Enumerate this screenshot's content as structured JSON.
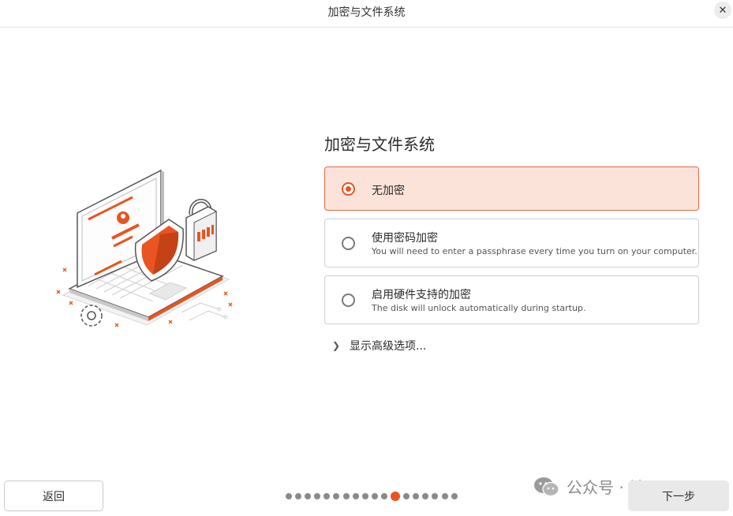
{
  "window": {
    "title": "加密与文件系统"
  },
  "main": {
    "heading": "加密与文件系统",
    "options": [
      {
        "label": "无加密",
        "description": "",
        "selected": true
      },
      {
        "label": "使用密码加密",
        "description": "You will need to enter a passphrase every time you turn on your computer.",
        "selected": false
      },
      {
        "label": "启用硬件支持的加密",
        "description": "The disk will unlock automatically during startup.",
        "selected": false
      }
    ],
    "advanced_label": "显示高级选项..."
  },
  "footer": {
    "back_label": "返回",
    "next_label": "下一步",
    "steps_total": 18,
    "steps_current": 12
  },
  "watermark": {
    "text": "公众号 · 铁军哥"
  },
  "colors": {
    "accent": "#e95420",
    "selected_bg": "#fbe3da",
    "selected_border": "#e36a3f"
  }
}
